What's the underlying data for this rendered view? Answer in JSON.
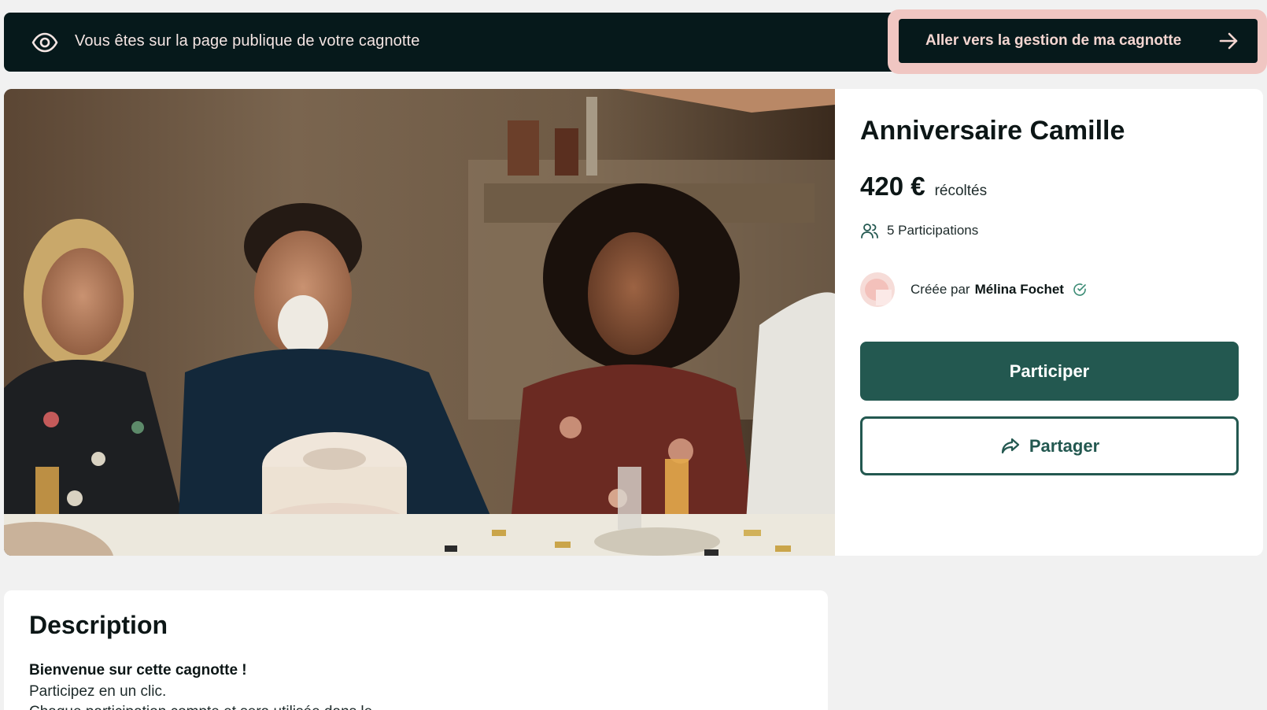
{
  "banner": {
    "icon": "eye-icon",
    "text": "Vous êtes sur la page publique de votre cagnotte",
    "manage_button_label": "Aller vers la gestion de ma cagnotte",
    "manage_button_icon": "arrow-right-icon"
  },
  "campaign": {
    "title": "Anniversaire Camille",
    "amount": "420 €",
    "amount_suffix": "récoltés",
    "participants_icon": "users-icon",
    "participants_text": "5 Participations",
    "creator_prefix": "Créée par",
    "creator_name": "Mélina Fochet",
    "verified_icon": "check-circle-icon",
    "participate_label": "Participer",
    "share_label": "Partager",
    "share_icon": "share-icon",
    "image": "birthday-party-photo"
  },
  "description": {
    "title": "Description",
    "intro": "Bienvenue sur cette cagnotte !",
    "line1": "Participez en un clic.",
    "line2": "Chaque participation compte et sera utilisée dans le"
  },
  "colors": {
    "banner_bg": "#06191b",
    "banner_text": "#f4e5e3",
    "highlight": "#f0c6c2",
    "primary": "#235850",
    "page_bg": "#f1f1f1"
  }
}
